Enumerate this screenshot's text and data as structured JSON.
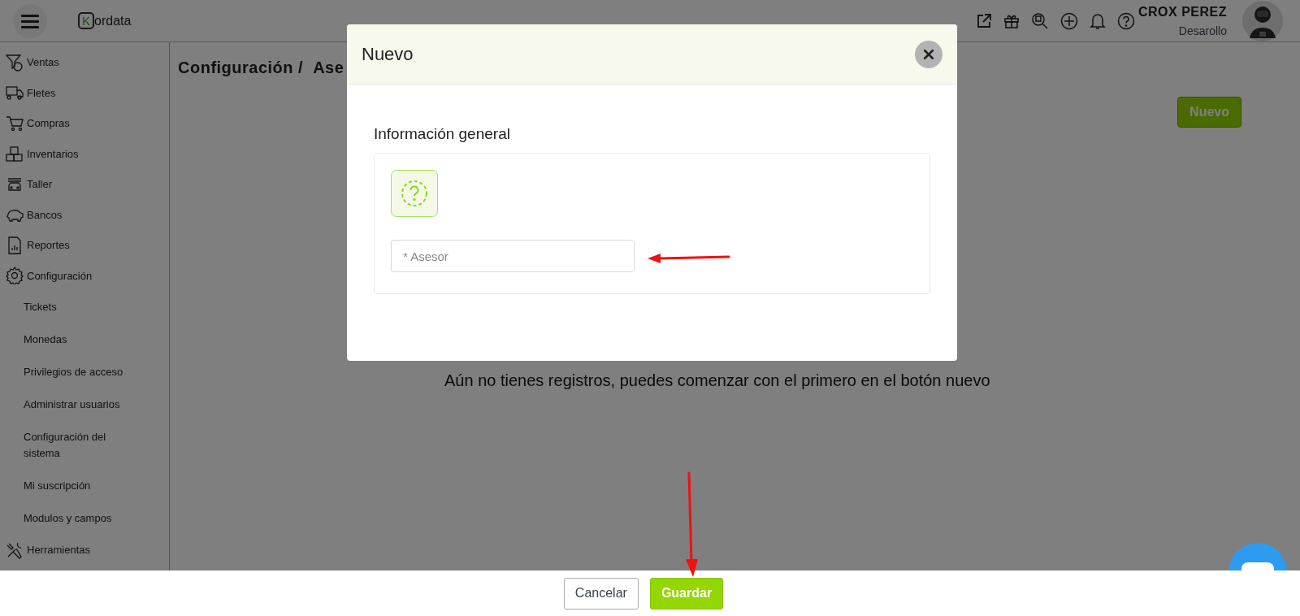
{
  "topbar": {
    "logo": {
      "letter": "K",
      "text": "ordata"
    },
    "user": {
      "name": "CROX PEREZ",
      "role": "Desarollo"
    }
  },
  "sidebar": {
    "items": [
      {
        "label": "Ventas"
      },
      {
        "label": "Fletes"
      },
      {
        "label": "Compras"
      },
      {
        "label": "Inventarios"
      },
      {
        "label": "Taller"
      },
      {
        "label": "Bancos"
      },
      {
        "label": "Reportes"
      },
      {
        "label": "Configuración",
        "children": [
          {
            "label": "Tickets"
          },
          {
            "label": "Monedas"
          },
          {
            "label": "Privilegios de acceso"
          },
          {
            "label": "Administrar usuarios"
          },
          {
            "label": "Configuración del sistema"
          },
          {
            "label": "Mi suscripción"
          },
          {
            "label": "Modulos y campos"
          }
        ]
      },
      {
        "label": "Herramientas"
      }
    ]
  },
  "page": {
    "breadcrumb": [
      "Configuración /",
      "Ase"
    ],
    "new_button": "Nuevo",
    "empty_message": "Aún no tienes registros, puedes comenzar con el primero en el botón nuevo"
  },
  "modal": {
    "title": "Nuevo",
    "section_title": "Información general",
    "field": {
      "placeholder": "* Asesor"
    }
  },
  "footer": {
    "buttons": [
      {
        "label": "Cancelar",
        "kind": "secondary"
      },
      {
        "label": "Guardar",
        "kind": "primary"
      }
    ]
  }
}
